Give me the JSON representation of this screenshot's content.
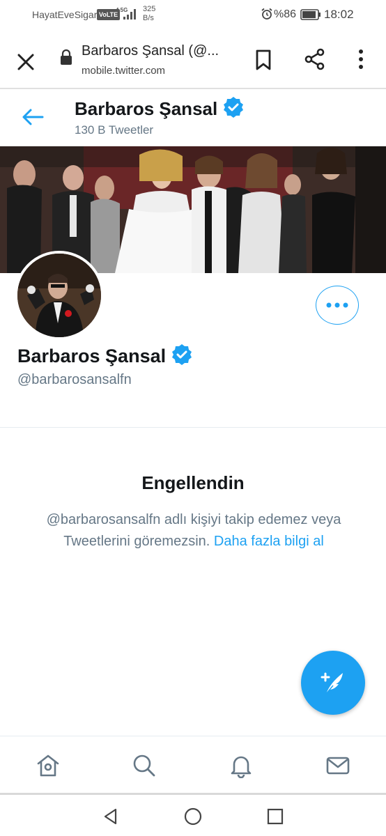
{
  "status_bar": {
    "carrier": "HayatEveSigar",
    "volte": "VoLTE",
    "network": "4.5G",
    "speed_value": "325",
    "speed_unit": "B/s",
    "battery_percent": "%86",
    "time": "18:02"
  },
  "browser": {
    "page_title": "Barbaros Şansal (@...",
    "url": "mobile.twitter.com"
  },
  "header": {
    "name": "Barbaros Şansal",
    "tweet_count": "130 B Tweetler"
  },
  "profile": {
    "name": "Barbaros Şansal",
    "handle": "@barbarosansalfn"
  },
  "blocked": {
    "title": "Engellendin",
    "message": "@barbarosansalfn adlı kişiyi takip edemez veya Tweetlerini göremezsin.",
    "link": "Daha fazla bilgi al"
  },
  "colors": {
    "accent": "#1da1f2",
    "text_primary": "#14171a",
    "text_secondary": "#657786"
  },
  "icons": {
    "back": "arrow-left-icon",
    "verified": "verified-badge-icon",
    "more": "more-horizontal-icon",
    "compose": "compose-tweet-icon",
    "home": "home-icon",
    "search": "search-icon",
    "notifications": "bell-icon",
    "messages": "mail-icon"
  }
}
